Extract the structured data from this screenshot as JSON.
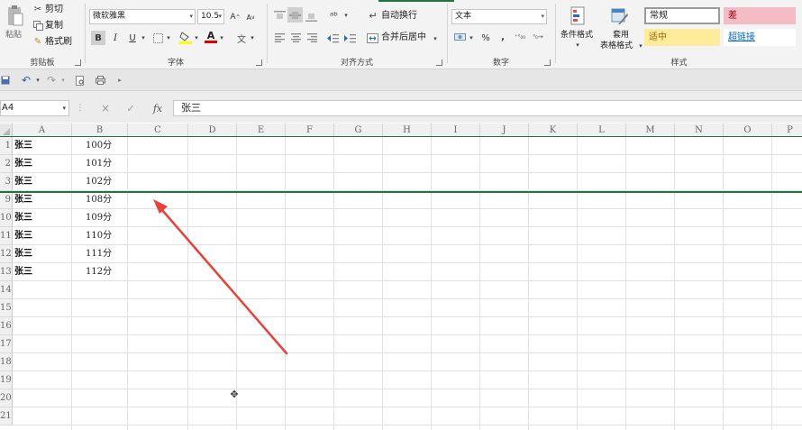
{
  "ribbon": {
    "clipboard": {
      "paste": "粘贴",
      "cut": "剪切",
      "copy": "复制",
      "format_painter": "格式刷",
      "label": "剪贴板"
    },
    "font": {
      "family": "微软雅黑",
      "size": "10.5",
      "grow": "A",
      "shrink": "A",
      "bold": "B",
      "italic": "I",
      "underline": "U",
      "font_color": "A",
      "phonetic": "文",
      "label": "字体"
    },
    "alignment": {
      "wrap_text": "自动换行",
      "merge_center": "合并后居中",
      "label": "对齐方式"
    },
    "number": {
      "format": "文本",
      "percent": "%",
      "comma": ",",
      "label": "数字"
    },
    "styles": {
      "conditional": "条件格式",
      "table_format_1": "套用",
      "table_format_2": "表格格式",
      "normal": "常规",
      "bad": "差",
      "neutral": "适中",
      "hyperlink": "超链接",
      "label": "样式",
      "colors": {
        "bad_bg": "#f4bcc4",
        "bad_text": "#9c0006",
        "neutral_bg": "#feeb9c",
        "neutral_text": "#9c6500",
        "hyperlink_text": "#0563c1"
      }
    }
  },
  "formula_bar": {
    "name_box": "A4",
    "cancel": "×",
    "enter": "✓",
    "fx": "fx",
    "content": "张三"
  },
  "columns": [
    "A",
    "B",
    "C",
    "D",
    "E",
    "F",
    "G",
    "H",
    "I",
    "J",
    "K",
    "L",
    "M",
    "N",
    "O",
    "P"
  ],
  "rows": [
    {
      "num": "1",
      "a": "张三",
      "b": "100分"
    },
    {
      "num": "2",
      "a": "张三",
      "b": "101分"
    },
    {
      "num": "3",
      "a": "张三",
      "b": "102分"
    },
    {
      "num": "9",
      "a": "张三",
      "b": "108分"
    },
    {
      "num": "10",
      "a": "张三",
      "b": "109分"
    },
    {
      "num": "11",
      "a": "张三",
      "b": "110分"
    },
    {
      "num": "12",
      "a": "张三",
      "b": "111分"
    },
    {
      "num": "13",
      "a": "张三",
      "b": "112分"
    },
    {
      "num": "14",
      "a": "",
      "b": ""
    },
    {
      "num": "15",
      "a": "",
      "b": ""
    },
    {
      "num": "16",
      "a": "",
      "b": ""
    },
    {
      "num": "17",
      "a": "",
      "b": ""
    },
    {
      "num": "18",
      "a": "",
      "b": ""
    },
    {
      "num": "19",
      "a": "",
      "b": ""
    },
    {
      "num": "20",
      "a": "",
      "b": ""
    },
    {
      "num": "21",
      "a": "",
      "b": ""
    }
  ],
  "theme": {
    "accent": "#217346",
    "annotation_arrow": "#e8403a"
  }
}
